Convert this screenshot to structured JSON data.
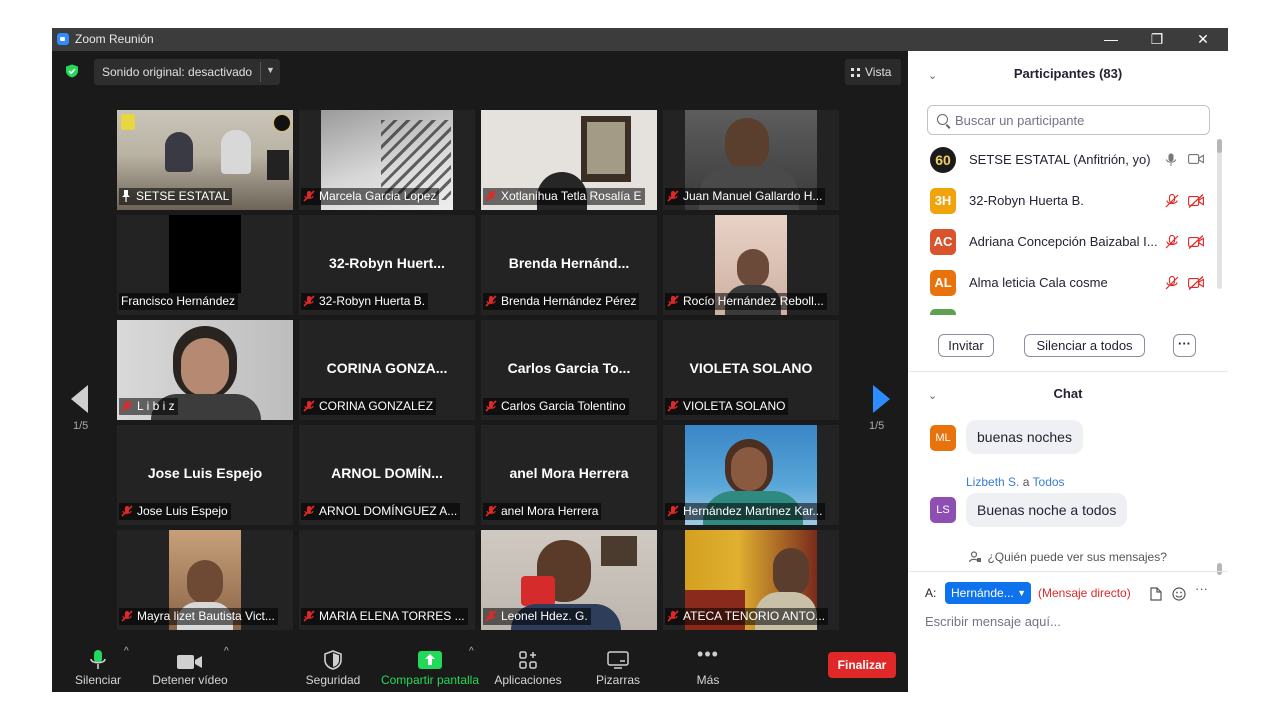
{
  "window": {
    "title": "Zoom Reunión",
    "controls": {
      "minimize": "—",
      "restore": "❐",
      "close": "✕"
    }
  },
  "meeting": {
    "audio_label": "Sonido original: desactivado",
    "view_label": "Vista",
    "page_left": "1/5",
    "page_right": "1/5",
    "tiles": [
      {
        "label": "SETSE ESTATAL",
        "big": "",
        "type": "video-setse",
        "pinned": true,
        "muted": false,
        "active": true
      },
      {
        "label": "Marcela Garcia Lopez",
        "big": "",
        "type": "video-marcela",
        "muted": true
      },
      {
        "label": "Xotlanihua Tetla Rosalía E",
        "big": "",
        "type": "video-xotla",
        "muted": true
      },
      {
        "label": "Juan Manuel Gallardo H...",
        "big": "",
        "type": "video-juan",
        "muted": true
      },
      {
        "label": "Francisco Hernández",
        "big": "",
        "type": "video-black",
        "muted": false
      },
      {
        "label": "32-Robyn Huerta B.",
        "big": "32-Robyn  Huert...",
        "type": "name",
        "muted": true
      },
      {
        "label": "Brenda Hernández Pérez",
        "big": "Brenda  Hernánd...",
        "type": "name",
        "muted": true
      },
      {
        "label": "Rocío Hernández Reboll...",
        "big": "",
        "type": "video-rocio",
        "muted": true
      },
      {
        "label": "L i b i z",
        "big": "",
        "type": "video-libiz",
        "muted": true
      },
      {
        "label": "CORINA GONZALEZ",
        "big": "CORINA  GONZA...",
        "type": "name",
        "muted": true
      },
      {
        "label": "Carlos Garcia Tolentino",
        "big": "Carlos Garcia To...",
        "type": "name",
        "muted": true
      },
      {
        "label": "VIOLETA SOLANO",
        "big": "VIOLETA SOLANO",
        "type": "name",
        "muted": true
      },
      {
        "label": "Jose Luis Espejo",
        "big": "Jose Luis Espejo",
        "type": "name",
        "muted": true
      },
      {
        "label": "ARNOL DOMÍNGUEZ A...",
        "big": "ARNOL  DOMÍN...",
        "type": "name",
        "muted": true
      },
      {
        "label": "anel Mora Herrera",
        "big": "anel Mora Herrera",
        "type": "name",
        "muted": true
      },
      {
        "label": "Hernández Martinez Kar...",
        "big": "",
        "type": "video-hernandez",
        "muted": true
      },
      {
        "label": "Mayra lizet Bautista Vict...",
        "big": "",
        "type": "video-mayra",
        "muted": true
      },
      {
        "label": "MARIA ELENA TORRES ...",
        "big": "",
        "type": "blank",
        "muted": true
      },
      {
        "label": "Leonel Hdez. G.",
        "big": "",
        "type": "video-leonel",
        "muted": true
      },
      {
        "label": "ATECA TENORIO ANTO...",
        "big": "",
        "type": "video-ateca",
        "muted": true
      }
    ]
  },
  "toolbar": {
    "mute": "Silenciar",
    "video": "Detener vídeo",
    "security": "Seguridad",
    "share": "Compartir pantalla",
    "apps": "Aplicaciones",
    "whiteboards": "Pizarras",
    "more": "Más",
    "end": "Finalizar"
  },
  "participants": {
    "header": "Participantes (83)",
    "search_placeholder": "Buscar un participante",
    "list": [
      {
        "initials": "60",
        "name": "SETSE ESTATAL (Anfitrión, yo)",
        "color": "#1b1b1b",
        "state": "host"
      },
      {
        "initials": "3H",
        "name": "32-Robyn Huerta B.",
        "color": "#f0a30a",
        "state": "muted"
      },
      {
        "initials": "AC",
        "name": "Adriana Concepción Baizabal I...",
        "color": "#d9532c",
        "state": "muted"
      },
      {
        "initials": "AL",
        "name": "Alma leticia Cala cosme",
        "color": "#e8730c",
        "state": "muted"
      }
    ],
    "invite": "Invitar",
    "mute_all": "Silenciar a todos",
    "more": "···"
  },
  "chat": {
    "header": "Chat",
    "messages": [
      {
        "initials": "ML",
        "color": "#e8730c",
        "sender": "",
        "to": "",
        "text": "buenas noches"
      },
      {
        "initials": "LS",
        "color": "#8e4fb3",
        "sender": "Lizbeth S.",
        "to": "Todos",
        "connector": "a",
        "text": "Buenas noche a todos"
      }
    ],
    "who_can_see": "¿Quién puede ver sus mensajes?",
    "to_label": "A:",
    "recipient": "Hernánde...",
    "direct_label": "(Mensaje directo)",
    "input_placeholder": "Escribir mensaje aquí...",
    "more": "···"
  }
}
